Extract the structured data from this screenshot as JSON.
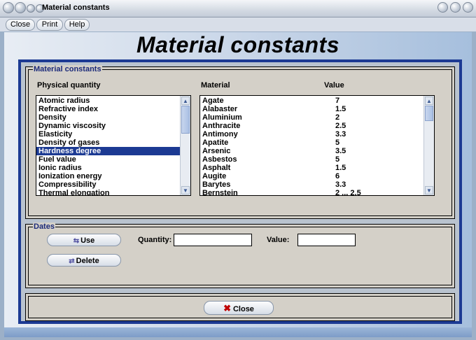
{
  "window": {
    "title": "Material constants"
  },
  "menu": [
    {
      "label": "Close"
    },
    {
      "label": "Print"
    },
    {
      "label": "Help"
    }
  ],
  "heading": "Material constants",
  "constants_group": {
    "legend": "Material constants",
    "col_physical": "Physical quantity",
    "col_material": "Material",
    "col_value": "Value",
    "physical_quantities": [
      "Atomic radius",
      "Refractive index",
      "Density",
      "Dynamic viscosity",
      "Elasticity",
      "Density of gases",
      "Hardness degree",
      "Fuel value",
      "Ionic radius",
      "Ionization energy",
      "Compressibility",
      "Thermal elongation"
    ],
    "selected_quantity": "Hardness degree",
    "materials": [
      {
        "name": "Agate",
        "value": "7"
      },
      {
        "name": "Alabaster",
        "value": "1.5"
      },
      {
        "name": "Aluminium",
        "value": "2"
      },
      {
        "name": "Anthracite",
        "value": "2.5"
      },
      {
        "name": "Antimony",
        "value": "3.3"
      },
      {
        "name": "Apatite",
        "value": "5"
      },
      {
        "name": "Arsenic",
        "value": "3.5"
      },
      {
        "name": "Asbestos",
        "value": "5"
      },
      {
        "name": "Asphalt",
        "value": "1.5"
      },
      {
        "name": "Augite",
        "value": "6"
      },
      {
        "name": "Barytes",
        "value": "3.3"
      },
      {
        "name": "Bernstein",
        "value": "2 ... 2.5"
      }
    ]
  },
  "dates_group": {
    "legend": "Dates",
    "use_label": "Use",
    "delete_label": "Delete",
    "quantity_label": "Quantity:",
    "quantity_value": "",
    "value_label": "Value:",
    "value_value": ""
  },
  "footer": {
    "close_label": "Close"
  },
  "colors": {
    "accent": "#1c3a93",
    "panel": "#d4d0c8",
    "close_icon": "#c00000"
  }
}
